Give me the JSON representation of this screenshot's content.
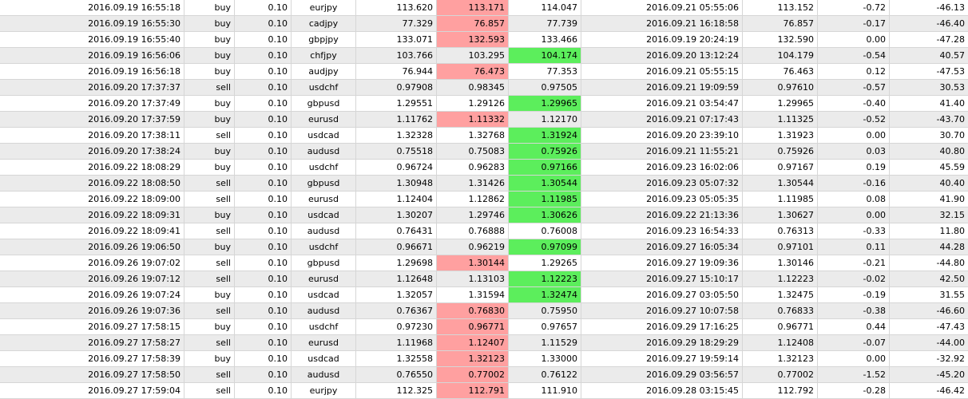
{
  "colors": {
    "row_alt": "#ebebeb",
    "loss_highlight": "#ffa0a0",
    "win_highlight": "#5cee5c",
    "grid_line": "#d6d6d6"
  },
  "trades": [
    {
      "open_time": "2016.09.19 16:55:18",
      "type": "buy",
      "lots": "0.10",
      "symbol": "eurjpy",
      "open_price": "113.620",
      "sl": "113.171",
      "tp": "114.047",
      "highlight": "sl",
      "close_time": "2016.09.21 05:55:06",
      "close_price": "113.152",
      "swap": "-0.72",
      "profit": "-46.13"
    },
    {
      "open_time": "2016.09.19 16:55:30",
      "type": "buy",
      "lots": "0.10",
      "symbol": "cadjpy",
      "open_price": "77.329",
      "sl": "76.857",
      "tp": "77.739",
      "highlight": "sl",
      "close_time": "2016.09.21 16:18:58",
      "close_price": "76.857",
      "swap": "-0.17",
      "profit": "-46.40"
    },
    {
      "open_time": "2016.09.19 16:55:40",
      "type": "buy",
      "lots": "0.10",
      "symbol": "gbpjpy",
      "open_price": "133.071",
      "sl": "132.593",
      "tp": "133.466",
      "highlight": "sl",
      "close_time": "2016.09.19 20:24:19",
      "close_price": "132.590",
      "swap": "0.00",
      "profit": "-47.28"
    },
    {
      "open_time": "2016.09.19 16:56:06",
      "type": "buy",
      "lots": "0.10",
      "symbol": "chfjpy",
      "open_price": "103.766",
      "sl": "103.295",
      "tp": "104.174",
      "highlight": "tp",
      "close_time": "2016.09.20 13:12:24",
      "close_price": "104.179",
      "swap": "-0.54",
      "profit": "40.57"
    },
    {
      "open_time": "2016.09.19 16:56:18",
      "type": "buy",
      "lots": "0.10",
      "symbol": "audjpy",
      "open_price": "76.944",
      "sl": "76.473",
      "tp": "77.353",
      "highlight": "sl",
      "close_time": "2016.09.21 05:55:15",
      "close_price": "76.463",
      "swap": "0.12",
      "profit": "-47.53"
    },
    {
      "open_time": "2016.09.20 17:37:37",
      "type": "sell",
      "lots": "0.10",
      "symbol": "usdchf",
      "open_price": "0.97908",
      "sl": "0.98345",
      "tp": "0.97505",
      "highlight": "",
      "close_time": "2016.09.21 19:09:59",
      "close_price": "0.97610",
      "swap": "-0.57",
      "profit": "30.53"
    },
    {
      "open_time": "2016.09.20 17:37:49",
      "type": "buy",
      "lots": "0.10",
      "symbol": "gbpusd",
      "open_price": "1.29551",
      "sl": "1.29126",
      "tp": "1.29965",
      "highlight": "tp",
      "close_time": "2016.09.21 03:54:47",
      "close_price": "1.29965",
      "swap": "-0.40",
      "profit": "41.40"
    },
    {
      "open_time": "2016.09.20 17:37:59",
      "type": "buy",
      "lots": "0.10",
      "symbol": "eurusd",
      "open_price": "1.11762",
      "sl": "1.11332",
      "tp": "1.12170",
      "highlight": "sl",
      "close_time": "2016.09.21 07:17:43",
      "close_price": "1.11325",
      "swap": "-0.52",
      "profit": "-43.70"
    },
    {
      "open_time": "2016.09.20 17:38:11",
      "type": "sell",
      "lots": "0.10",
      "symbol": "usdcad",
      "open_price": "1.32328",
      "sl": "1.32768",
      "tp": "1.31924",
      "highlight": "tp",
      "close_time": "2016.09.20 23:39:10",
      "close_price": "1.31923",
      "swap": "0.00",
      "profit": "30.70"
    },
    {
      "open_time": "2016.09.20 17:38:24",
      "type": "buy",
      "lots": "0.10",
      "symbol": "audusd",
      "open_price": "0.75518",
      "sl": "0.75083",
      "tp": "0.75926",
      "highlight": "tp",
      "close_time": "2016.09.21 11:55:21",
      "close_price": "0.75926",
      "swap": "0.03",
      "profit": "40.80"
    },
    {
      "open_time": "2016.09.22 18:08:29",
      "type": "buy",
      "lots": "0.10",
      "symbol": "usdchf",
      "open_price": "0.96724",
      "sl": "0.96283",
      "tp": "0.97166",
      "highlight": "tp",
      "close_time": "2016.09.23 16:02:06",
      "close_price": "0.97167",
      "swap": "0.19",
      "profit": "45.59"
    },
    {
      "open_time": "2016.09.22 18:08:50",
      "type": "sell",
      "lots": "0.10",
      "symbol": "gbpusd",
      "open_price": "1.30948",
      "sl": "1.31426",
      "tp": "1.30544",
      "highlight": "tp",
      "close_time": "2016.09.23 05:07:32",
      "close_price": "1.30544",
      "swap": "-0.16",
      "profit": "40.40"
    },
    {
      "open_time": "2016.09.22 18:09:00",
      "type": "sell",
      "lots": "0.10",
      "symbol": "eurusd",
      "open_price": "1.12404",
      "sl": "1.12862",
      "tp": "1.11985",
      "highlight": "tp",
      "close_time": "2016.09.23 05:05:35",
      "close_price": "1.11985",
      "swap": "0.08",
      "profit": "41.90"
    },
    {
      "open_time": "2016.09.22 18:09:31",
      "type": "buy",
      "lots": "0.10",
      "symbol": "usdcad",
      "open_price": "1.30207",
      "sl": "1.29746",
      "tp": "1.30626",
      "highlight": "tp",
      "close_time": "2016.09.22 21:13:36",
      "close_price": "1.30627",
      "swap": "0.00",
      "profit": "32.15"
    },
    {
      "open_time": "2016.09.22 18:09:41",
      "type": "sell",
      "lots": "0.10",
      "symbol": "audusd",
      "open_price": "0.76431",
      "sl": "0.76888",
      "tp": "0.76008",
      "highlight": "",
      "close_time": "2016.09.23 16:54:33",
      "close_price": "0.76313",
      "swap": "-0.33",
      "profit": "11.80"
    },
    {
      "open_time": "2016.09.26 19:06:50",
      "type": "buy",
      "lots": "0.10",
      "symbol": "usdchf",
      "open_price": "0.96671",
      "sl": "0.96219",
      "tp": "0.97099",
      "highlight": "tp",
      "close_time": "2016.09.27 16:05:34",
      "close_price": "0.97101",
      "swap": "0.11",
      "profit": "44.28"
    },
    {
      "open_time": "2016.09.26 19:07:02",
      "type": "sell",
      "lots": "0.10",
      "symbol": "gbpusd",
      "open_price": "1.29698",
      "sl": "1.30144",
      "tp": "1.29265",
      "highlight": "sl",
      "close_time": "2016.09.27 19:09:36",
      "close_price": "1.30146",
      "swap": "-0.21",
      "profit": "-44.80"
    },
    {
      "open_time": "2016.09.26 19:07:12",
      "type": "sell",
      "lots": "0.10",
      "symbol": "eurusd",
      "open_price": "1.12648",
      "sl": "1.13103",
      "tp": "1.12223",
      "highlight": "tp",
      "close_time": "2016.09.27 15:10:17",
      "close_price": "1.12223",
      "swap": "-0.02",
      "profit": "42.50"
    },
    {
      "open_time": "2016.09.26 19:07:24",
      "type": "buy",
      "lots": "0.10",
      "symbol": "usdcad",
      "open_price": "1.32057",
      "sl": "1.31594",
      "tp": "1.32474",
      "highlight": "tp",
      "close_time": "2016.09.27 03:05:50",
      "close_price": "1.32475",
      "swap": "-0.19",
      "profit": "31.55"
    },
    {
      "open_time": "2016.09.26 19:07:36",
      "type": "sell",
      "lots": "0.10",
      "symbol": "audusd",
      "open_price": "0.76367",
      "sl": "0.76830",
      "tp": "0.75950",
      "highlight": "sl",
      "close_time": "2016.09.27 10:07:58",
      "close_price": "0.76833",
      "swap": "-0.38",
      "profit": "-46.60"
    },
    {
      "open_time": "2016.09.27 17:58:15",
      "type": "buy",
      "lots": "0.10",
      "symbol": "usdchf",
      "open_price": "0.97230",
      "sl": "0.96771",
      "tp": "0.97657",
      "highlight": "sl",
      "close_time": "2016.09.29 17:16:25",
      "close_price": "0.96771",
      "swap": "0.44",
      "profit": "-47.43"
    },
    {
      "open_time": "2016.09.27 17:58:27",
      "type": "sell",
      "lots": "0.10",
      "symbol": "eurusd",
      "open_price": "1.11968",
      "sl": "1.12407",
      "tp": "1.11529",
      "highlight": "sl",
      "close_time": "2016.09.29 18:29:29",
      "close_price": "1.12408",
      "swap": "-0.07",
      "profit": "-44.00"
    },
    {
      "open_time": "2016.09.27 17:58:39",
      "type": "buy",
      "lots": "0.10",
      "symbol": "usdcad",
      "open_price": "1.32558",
      "sl": "1.32123",
      "tp": "1.33000",
      "highlight": "sl",
      "close_time": "2016.09.27 19:59:14",
      "close_price": "1.32123",
      "swap": "0.00",
      "profit": "-32.92"
    },
    {
      "open_time": "2016.09.27 17:58:50",
      "type": "sell",
      "lots": "0.10",
      "symbol": "audusd",
      "open_price": "0.76550",
      "sl": "0.77002",
      "tp": "0.76122",
      "highlight": "sl",
      "close_time": "2016.09.29 03:56:57",
      "close_price": "0.77002",
      "swap": "-1.52",
      "profit": "-45.20"
    },
    {
      "open_time": "2016.09.27 17:59:04",
      "type": "sell",
      "lots": "0.10",
      "symbol": "eurjpy",
      "open_price": "112.325",
      "sl": "112.791",
      "tp": "111.910",
      "highlight": "sl",
      "close_time": "2016.09.28 03:15:45",
      "close_price": "112.792",
      "swap": "-0.28",
      "profit": "-46.42"
    }
  ]
}
